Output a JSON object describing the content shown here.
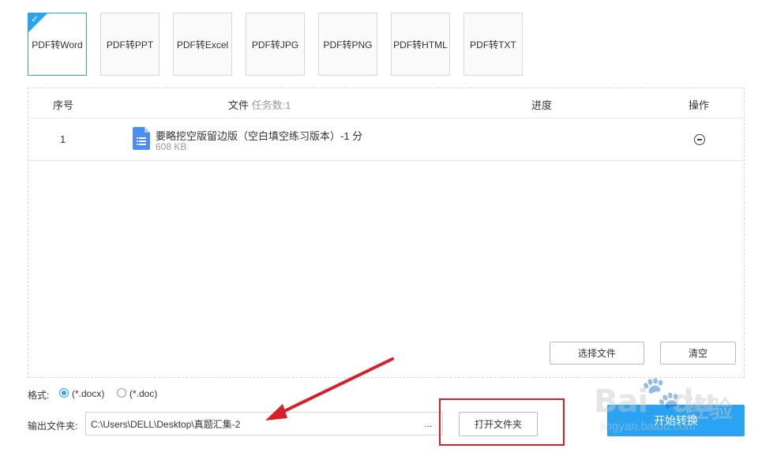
{
  "tabs": [
    {
      "label": "PDF转Word",
      "active": true
    },
    {
      "label": "PDF转PPT",
      "active": false
    },
    {
      "label": "PDF转Excel",
      "active": false
    },
    {
      "label": "PDF转JPG",
      "active": false
    },
    {
      "label": "PDF转PNG",
      "active": false
    },
    {
      "label": "PDF转HTML",
      "active": false
    },
    {
      "label": "PDF转TXT",
      "active": false
    }
  ],
  "table": {
    "headers": {
      "seq": "序号",
      "file": "文件",
      "task_count": "任务数:1",
      "progress": "进度",
      "action": "操作"
    },
    "rows": [
      {
        "seq": "1",
        "name": "要略挖空版留边版（空白填空练习版本）-1 分",
        "size": "608 KB",
        "icon": "document-icon"
      }
    ]
  },
  "panel_buttons": {
    "select": "选择文件",
    "clear": "清空"
  },
  "format": {
    "label": "格式:",
    "options": [
      {
        "label": "(*.docx)",
        "checked": true
      },
      {
        "label": "(*.doc)",
        "checked": false
      }
    ]
  },
  "output": {
    "label": "输出文件夹:",
    "path": "C:\\Users\\DELL\\Desktop\\真题汇集-2",
    "browse": "...",
    "open_folder": "打开文件夹"
  },
  "start_button": "开始转换",
  "watermark": {
    "brand": "Bai",
    "brand_suffix": "du",
    "cn": "经验",
    "url": "jingyan.baidu.com"
  },
  "colors": {
    "accent": "#2aa3f2",
    "annotation": "#d6212b"
  }
}
